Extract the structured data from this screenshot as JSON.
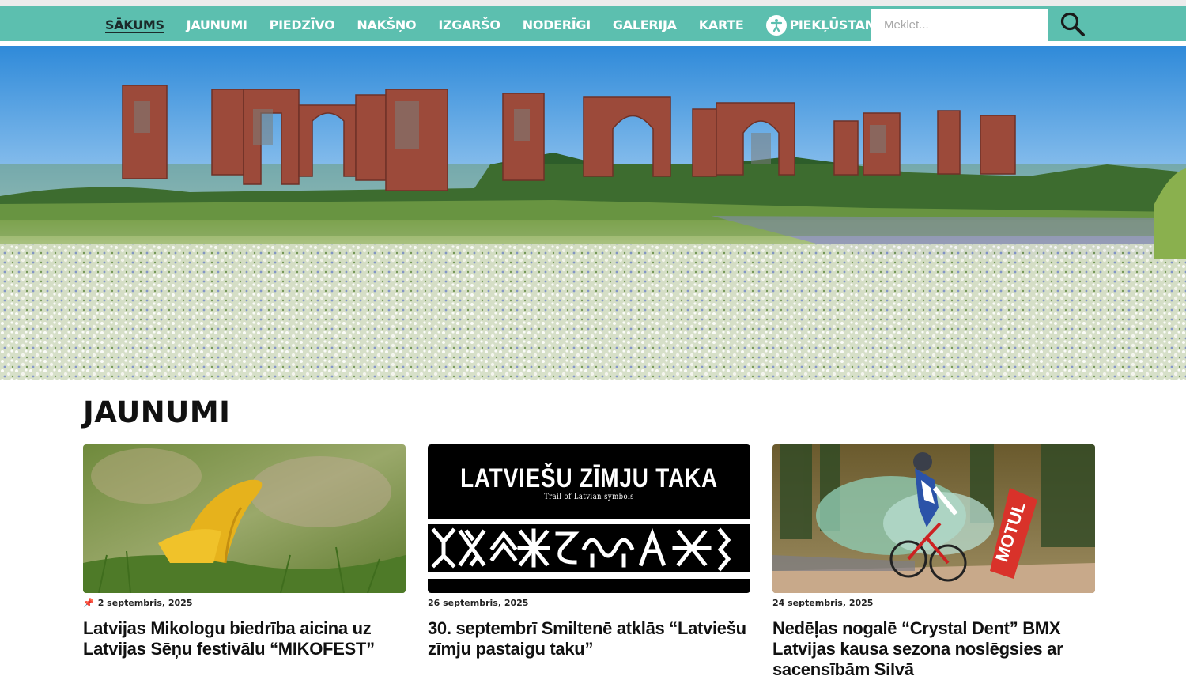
{
  "nav": {
    "items": [
      {
        "label": "SĀKUMS",
        "active": true
      },
      {
        "label": "JAUNUMI"
      },
      {
        "label": "PIEDZĪVO"
      },
      {
        "label": "NAKŠŅO"
      },
      {
        "label": "IZGARŠO"
      },
      {
        "label": "NODERĪGI"
      },
      {
        "label": "GALERIJA"
      },
      {
        "label": "KARTE"
      }
    ],
    "accessibility_label": "PIEKĻŪSTAMĪBA",
    "accessibility_icon": "accessibility-icon"
  },
  "search": {
    "placeholder": "Meklēt...",
    "value": "",
    "icon": "search-icon"
  },
  "colors": {
    "nav_bg": "#5cbfaf",
    "nav_text": "#ffffff",
    "active_text": "#1b2a2a",
    "pin": "#d23a3a"
  },
  "news": {
    "heading": "JAUNUMI",
    "cards": [
      {
        "date": "2 septembris, 2025",
        "pinned": true,
        "title": "Latvijas Mikologu biedrība aicina uz Latvijas Sēņu festivālu “MIKOFEST”"
      },
      {
        "date": "26 septembris, 2025",
        "title": "30. septembrī Smiltenē atklās “Latviešu zīmju pastaigu taku”",
        "image_title": "LATVIEŠU ZĪMJU TAKA",
        "image_subtitle": "Trail of Latvian symbols"
      },
      {
        "date": "24 septembris, 2025",
        "title": "Nedēļas nogalē “Crystal Dent” BMX Latvijas kausa sezona noslēgsies ar sacensībām Silvā",
        "image_banner": "MOTUL"
      }
    ]
  }
}
